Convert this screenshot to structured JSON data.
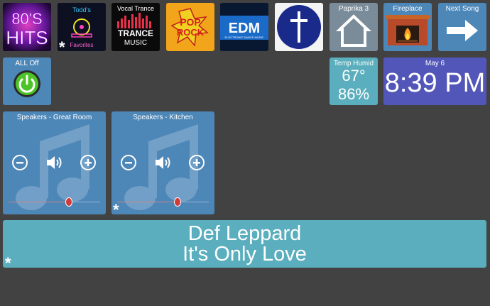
{
  "albums": [
    {
      "label_1": "80'S",
      "label_2": "HITS"
    },
    {
      "label_1": "Todd's",
      "label_2": "Favorites"
    },
    {
      "label_1": "Vocal Trance",
      "label_2": "TRANCE",
      "label_3": "MUSIC"
    },
    {
      "label_1": "POP",
      "label_2": "ROCK"
    },
    {
      "label_1": "EDM",
      "label_2": "ELECTRONIC DANCE MUSIC"
    }
  ],
  "tiles": {
    "paprika": {
      "title": "Paprika 3"
    },
    "fireplace": {
      "title": "Fireplace"
    },
    "next_song": {
      "title": "Next Song"
    },
    "all_off": {
      "title": "ALL Off"
    },
    "temp_humid": {
      "title": "Temp Humid",
      "temperature": "67°",
      "humidity": "86%"
    },
    "clock": {
      "date": "May 6",
      "time": "8:39 PM"
    }
  },
  "speakers": [
    {
      "title": "Speakers - Great Room",
      "volume": 0.66
    },
    {
      "title": "Speakers - Kitchen",
      "volume": 0.66
    }
  ],
  "now_playing": {
    "artist": "Def Leppard",
    "song": "It's Only Love"
  },
  "star_glyph": "*",
  "colors": {
    "tile_blue": "#4d87b8",
    "tile_teal": "#5aaebd",
    "tile_purple": "#5256b8",
    "background": "#424242"
  },
  "icons": [
    "home-icon",
    "fireplace-icon",
    "arrow-right-icon",
    "power-icon",
    "cross-icon",
    "music-note-icon",
    "volume-icon",
    "minus-icon",
    "plus-icon"
  ]
}
